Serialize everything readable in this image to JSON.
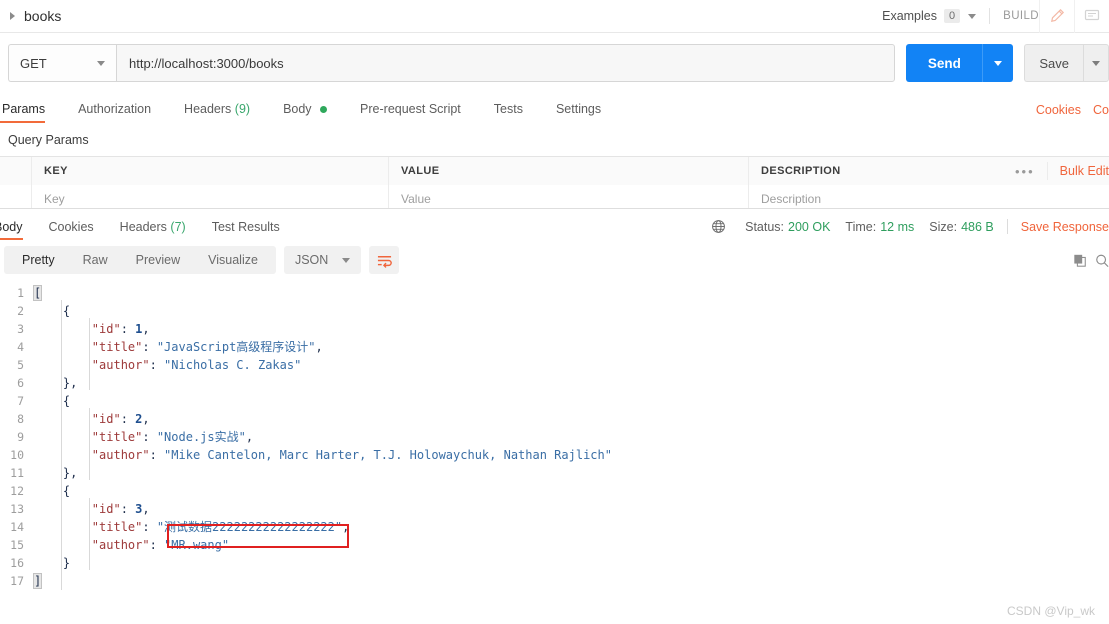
{
  "topbar": {
    "breadcrumb": "books",
    "examples_label": "Examples",
    "examples_count": "0",
    "build_label": "BUILD",
    "edit_icon": "pencil-icon",
    "comment_icon": "comment-icon"
  },
  "request": {
    "method": "GET",
    "url": "http://localhost:3000/books",
    "send_label": "Send",
    "save_label": "Save"
  },
  "request_tabs": [
    {
      "label": "Params",
      "active": true,
      "suffix": ""
    },
    {
      "label": "Authorization",
      "active": false,
      "suffix": ""
    },
    {
      "label": "Headers",
      "active": false,
      "suffix": "(9)"
    },
    {
      "label": "Body",
      "active": false,
      "suffix": "",
      "dot": true
    },
    {
      "label": "Pre-request Script",
      "active": false,
      "suffix": ""
    },
    {
      "label": "Tests",
      "active": false,
      "suffix": ""
    },
    {
      "label": "Settings",
      "active": false,
      "suffix": ""
    }
  ],
  "request_tabs_right": [
    {
      "label": "Cookies"
    },
    {
      "label": "Co"
    }
  ],
  "query_params": {
    "title": "Query Params",
    "headers": {
      "key": "KEY",
      "value": "VALUE",
      "description": "DESCRIPTION"
    },
    "row": {
      "key": "Key",
      "value": "Value",
      "description": "Description"
    },
    "more_icon": "overflow-dots-icon",
    "bulk_edit_label": "Bulk Edit"
  },
  "response_tabs": [
    {
      "label": "Body",
      "active": true,
      "suffix": ""
    },
    {
      "label": "Cookies",
      "active": false,
      "suffix": ""
    },
    {
      "label": "Headers",
      "active": false,
      "suffix": "(7)"
    },
    {
      "label": "Test Results",
      "active": false,
      "suffix": ""
    }
  ],
  "response_meta": {
    "globe_icon": "globe-icon",
    "status_label": "Status:",
    "status_value": "200 OK",
    "time_label": "Time:",
    "time_value": "12 ms",
    "size_label": "Size:",
    "size_value": "486 B",
    "save_response_label": "Save Response"
  },
  "body_toolbar": {
    "views": [
      {
        "label": "Pretty",
        "active": true
      },
      {
        "label": "Raw",
        "active": false
      },
      {
        "label": "Preview",
        "active": false
      },
      {
        "label": "Visualize",
        "active": false
      }
    ],
    "format": "JSON",
    "wrap_icon": "word-wrap-icon",
    "copy_icon": "copy-icon",
    "search_icon": "search-icon"
  },
  "response_body": {
    "language": "json",
    "lines": [
      {
        "n": "1",
        "tokens": [
          {
            "t": "[",
            "c": "br hl"
          }
        ]
      },
      {
        "n": "2",
        "tokens": [
          {
            "t": "    ",
            "c": "pun"
          },
          {
            "t": "{",
            "c": "br"
          }
        ]
      },
      {
        "n": "3",
        "tokens": [
          {
            "t": "        ",
            "c": "pun"
          },
          {
            "t": "\"id\"",
            "c": "key"
          },
          {
            "t": ": ",
            "c": "pun"
          },
          {
            "t": "1",
            "c": "num"
          },
          {
            "t": ",",
            "c": "pun"
          }
        ]
      },
      {
        "n": "4",
        "tokens": [
          {
            "t": "        ",
            "c": "pun"
          },
          {
            "t": "\"title\"",
            "c": "key"
          },
          {
            "t": ": ",
            "c": "pun"
          },
          {
            "t": "\"JavaScript高级程序设计\"",
            "c": "str"
          },
          {
            "t": ",",
            "c": "pun"
          }
        ]
      },
      {
        "n": "5",
        "tokens": [
          {
            "t": "        ",
            "c": "pun"
          },
          {
            "t": "\"author\"",
            "c": "key"
          },
          {
            "t": ": ",
            "c": "pun"
          },
          {
            "t": "\"Nicholas C. Zakas\"",
            "c": "str"
          }
        ]
      },
      {
        "n": "6",
        "tokens": [
          {
            "t": "    ",
            "c": "pun"
          },
          {
            "t": "}",
            "c": "br"
          },
          {
            "t": ",",
            "c": "pun"
          }
        ]
      },
      {
        "n": "7",
        "tokens": [
          {
            "t": "    ",
            "c": "pun"
          },
          {
            "t": "{",
            "c": "br"
          }
        ]
      },
      {
        "n": "8",
        "tokens": [
          {
            "t": "        ",
            "c": "pun"
          },
          {
            "t": "\"id\"",
            "c": "key"
          },
          {
            "t": ": ",
            "c": "pun"
          },
          {
            "t": "2",
            "c": "num"
          },
          {
            "t": ",",
            "c": "pun"
          }
        ]
      },
      {
        "n": "9",
        "tokens": [
          {
            "t": "        ",
            "c": "pun"
          },
          {
            "t": "\"title\"",
            "c": "key"
          },
          {
            "t": ": ",
            "c": "pun"
          },
          {
            "t": "\"Node.js实战\"",
            "c": "str"
          },
          {
            "t": ",",
            "c": "pun"
          }
        ]
      },
      {
        "n": "10",
        "tokens": [
          {
            "t": "        ",
            "c": "pun"
          },
          {
            "t": "\"author\"",
            "c": "key"
          },
          {
            "t": ": ",
            "c": "pun"
          },
          {
            "t": "\"Mike Cantelon, Marc Harter, T.J. Holowaychuk, Nathan Rajlich\"",
            "c": "str"
          }
        ]
      },
      {
        "n": "11",
        "tokens": [
          {
            "t": "    ",
            "c": "pun"
          },
          {
            "t": "}",
            "c": "br"
          },
          {
            "t": ",",
            "c": "pun"
          }
        ]
      },
      {
        "n": "12",
        "tokens": [
          {
            "t": "    ",
            "c": "pun"
          },
          {
            "t": "{",
            "c": "br"
          }
        ]
      },
      {
        "n": "13",
        "tokens": [
          {
            "t": "        ",
            "c": "pun"
          },
          {
            "t": "\"id\"",
            "c": "key"
          },
          {
            "t": ": ",
            "c": "pun"
          },
          {
            "t": "3",
            "c": "num"
          },
          {
            "t": ",",
            "c": "pun"
          }
        ]
      },
      {
        "n": "14",
        "tokens": [
          {
            "t": "        ",
            "c": "pun"
          },
          {
            "t": "\"title\"",
            "c": "key"
          },
          {
            "t": ": ",
            "c": "pun"
          },
          {
            "t": "\"测试数据22222222222222222\"",
            "c": "str"
          },
          {
            "t": ",",
            "c": "pun"
          }
        ]
      },
      {
        "n": "15",
        "tokens": [
          {
            "t": "        ",
            "c": "pun"
          },
          {
            "t": "\"author\"",
            "c": "key"
          },
          {
            "t": ": ",
            "c": "pun"
          },
          {
            "t": "\"MR.wang\"",
            "c": "str"
          }
        ]
      },
      {
        "n": "16",
        "tokens": [
          {
            "t": "    ",
            "c": "pun"
          },
          {
            "t": "}",
            "c": "br"
          }
        ]
      },
      {
        "n": "17",
        "tokens": [
          {
            "t": "]",
            "c": "br hl"
          }
        ]
      }
    ],
    "annotation": {
      "type": "red-rectangle-highlight",
      "target_line": "14",
      "target_text": "\"测试数据22222222222222222\","
    }
  },
  "watermark": "CSDN @Vip_wk",
  "colors": {
    "accent_orange": "#f26b3a",
    "send_blue": "#1283f5",
    "status_green": "#2f9e5e",
    "highlight_red": "#e02020"
  }
}
